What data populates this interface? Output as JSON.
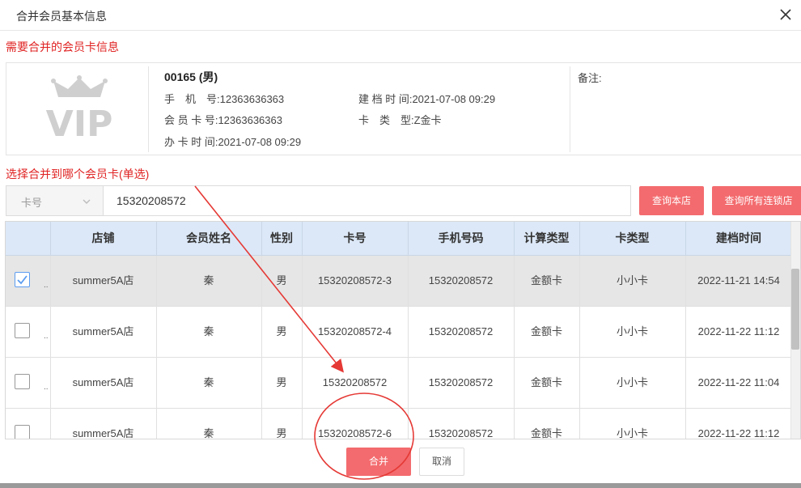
{
  "dialog": {
    "title": "合并会员基本信息"
  },
  "source_section": {
    "label": "需要合并的会员卡信息",
    "logo_text": "VIP",
    "member_name": "00165 (男)",
    "phone": "手　机　号:12363636363",
    "card_no": "会 员 卡 号:12363636363",
    "issue_time": "办 卡 时 间:2021-07-08 09:29",
    "create_time": "建 档 时 间:2021-07-08 09:29",
    "card_type": "卡　类　型:Z金卡",
    "remark_label": "备注:"
  },
  "target_section": {
    "label": "选择合并到哪个会员卡(单选)"
  },
  "search": {
    "field_select": "卡号",
    "value": "15320208572",
    "btn_store": "查询本店",
    "btn_all": "查询所有连锁店"
  },
  "table": {
    "columns": [
      "店铺",
      "会员姓名",
      "性别",
      "卡号",
      "手机号码",
      "计算类型",
      "卡类型",
      "建档时间"
    ],
    "rows": [
      {
        "selected": true,
        "store": "summer5A店",
        "name": "秦",
        "gender": "男",
        "card": "15320208572-3",
        "phone": "15320208572",
        "calc": "金额卡",
        "type": "小小卡",
        "time": "2022-11-21 14:54"
      },
      {
        "selected": false,
        "store": "summer5A店",
        "name": "秦",
        "gender": "男",
        "card": "15320208572-4",
        "phone": "15320208572",
        "calc": "金额卡",
        "type": "小小卡",
        "time": "2022-11-22 11:12"
      },
      {
        "selected": false,
        "store": "summer5A店",
        "name": "秦",
        "gender": "男",
        "card": "15320208572",
        "phone": "15320208572",
        "calc": "金额卡",
        "type": "小小卡",
        "time": "2022-11-22 11:04"
      },
      {
        "selected": false,
        "store": "summer5A店",
        "name": "秦",
        "gender": "男",
        "card": "15320208572-6",
        "phone": "15320208572",
        "calc": "金额卡",
        "type": "小小卡",
        "time": "2022-11-22 11:12"
      }
    ]
  },
  "actions": {
    "merge": "合并",
    "cancel": "取消"
  },
  "colors": {
    "accent_red": "#f36b6e",
    "label_red": "#e02424",
    "header_blue": "#dce8f7",
    "annotation_red": "#e53935"
  }
}
